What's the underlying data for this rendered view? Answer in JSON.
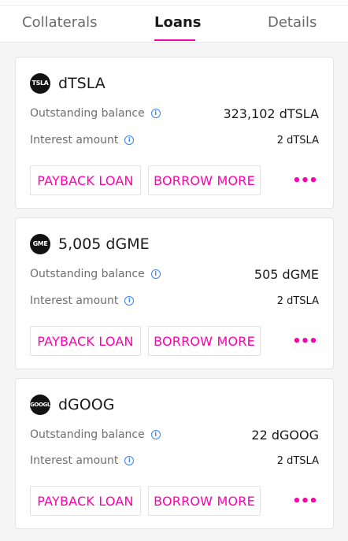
{
  "tabs": [
    {
      "label": "Collaterals",
      "active": false
    },
    {
      "label": "Loans",
      "active": true
    },
    {
      "label": "Details",
      "active": false
    }
  ],
  "colors": {
    "accent": "#ff00af",
    "info": "#3b82f6"
  },
  "loans": [
    {
      "badge": "TSLA",
      "title": "dTSLA",
      "outstanding_label": "Outstanding balance",
      "outstanding_value": "323,102 dTSLA",
      "interest_label": "Interest amount",
      "interest_value": "2 dTSLA",
      "payback_label": "PAYBACK LOAN",
      "borrow_label": "BORROW MORE",
      "more_label": "•••"
    },
    {
      "badge": "GME",
      "title": "5,005 dGME",
      "outstanding_label": "Outstanding balance",
      "outstanding_value": "505 dGME",
      "interest_label": "Interest amount",
      "interest_value": "2 dTSLA",
      "payback_label": "PAYBACK LOAN",
      "borrow_label": "BORROW MORE",
      "more_label": "•••"
    },
    {
      "badge": "GOOGL",
      "title": "dGOOG",
      "outstanding_label": "Outstanding balance",
      "outstanding_value": "22 dGOOG",
      "interest_label": "Interest amount",
      "interest_value": "2 dTSLA",
      "payback_label": "PAYBACK LOAN",
      "borrow_label": "BORROW MORE",
      "more_label": "•••"
    }
  ]
}
